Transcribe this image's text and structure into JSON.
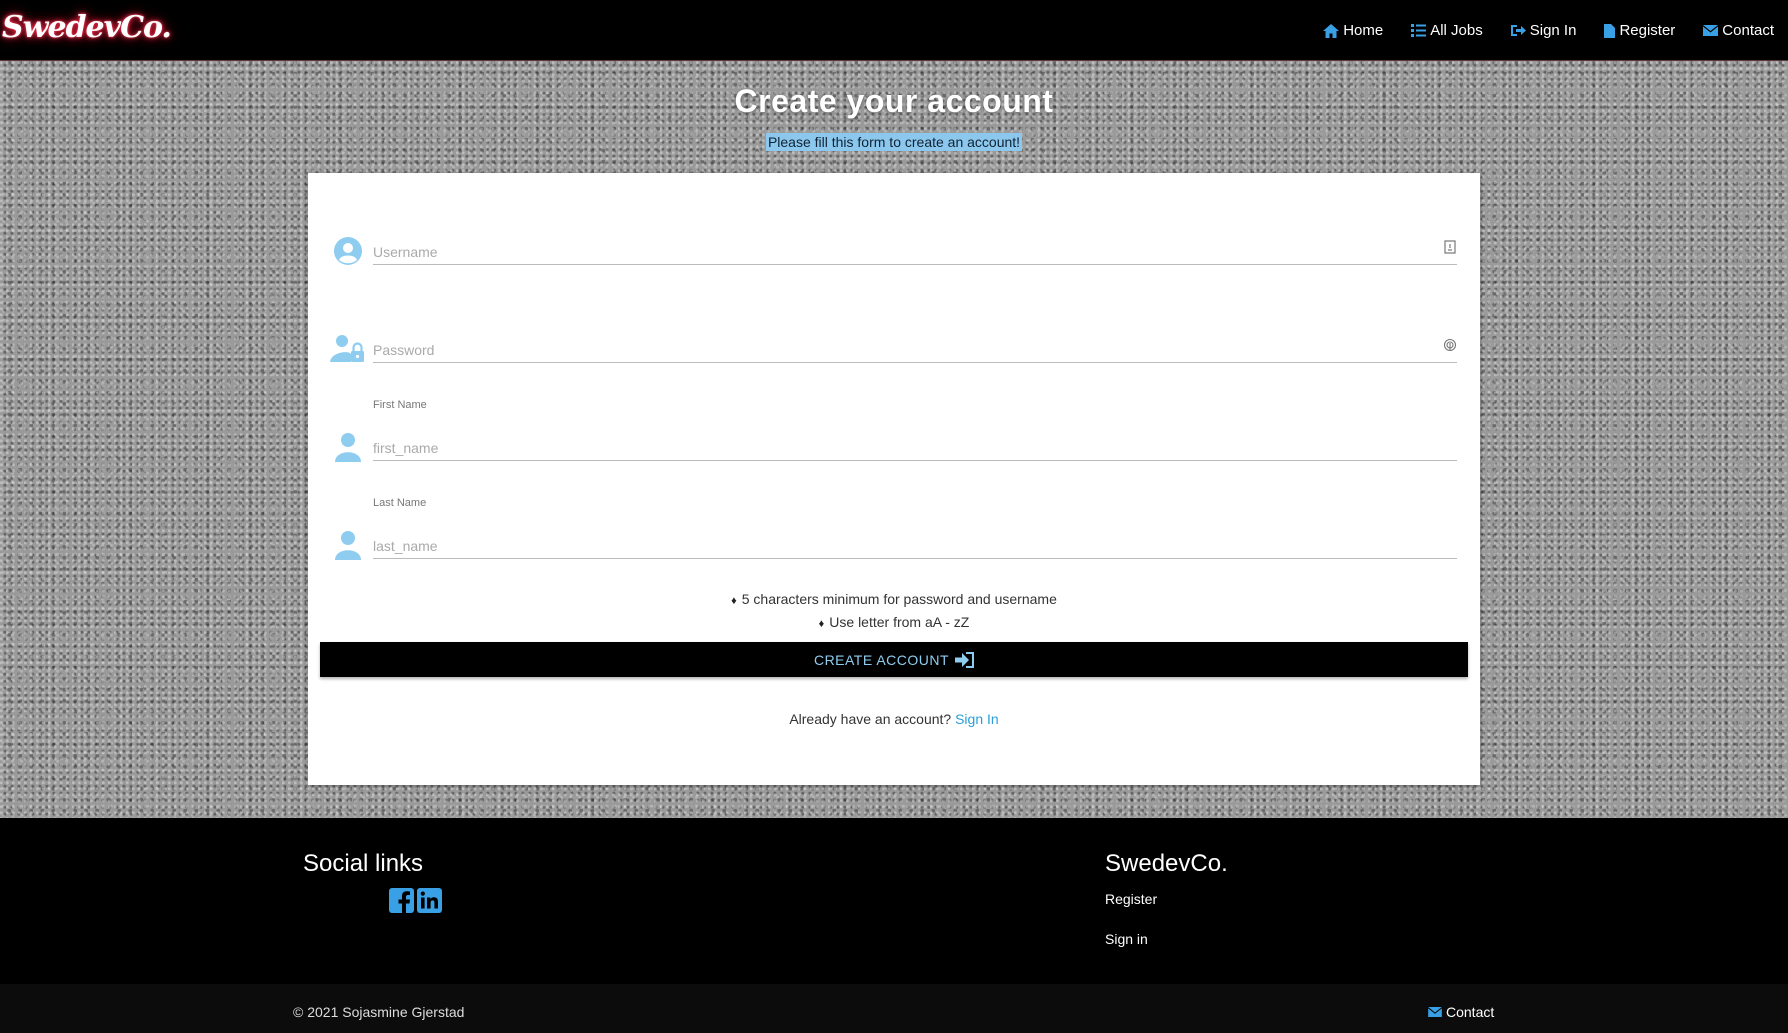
{
  "brand": "SwedevCo.",
  "nav": {
    "home": "Home",
    "all_jobs": "All Jobs",
    "sign_in": "Sign In",
    "register": "Register",
    "contact": "Contact"
  },
  "page": {
    "title": "Create your account",
    "subtitle": "Please fill this form to create an account!"
  },
  "form": {
    "username": {
      "label": "",
      "placeholder": "Username",
      "value": ""
    },
    "password": {
      "label": "",
      "placeholder": "Password",
      "value": ""
    },
    "first_name": {
      "label": "First Name",
      "placeholder": "first_name",
      "value": ""
    },
    "last_name": {
      "label": "Last Name",
      "placeholder": "last_name",
      "value": ""
    },
    "rules": [
      "5 characters minimum for password and username",
      "Use letter from aA - zZ"
    ],
    "rule_bullet": "♦",
    "submit_label": "CREATE ACCOUNT",
    "signin_prompt": "Already have an account?",
    "signin_link": "Sign In"
  },
  "footer": {
    "social_title": "Social links",
    "social_icons": [
      "facebook-icon",
      "linkedin-icon"
    ],
    "brand_title": "SwedevCo.",
    "links": [
      "Register",
      "Sign in"
    ],
    "copyright": "© 2021 Sojasmine Gjerstad",
    "contact": "Contact"
  },
  "colors": {
    "accent": "#8ecdf0",
    "link": "#2a9fd6",
    "nav_icon": "#3aa0e6",
    "subtitle_highlight": "#8cc8ee"
  }
}
